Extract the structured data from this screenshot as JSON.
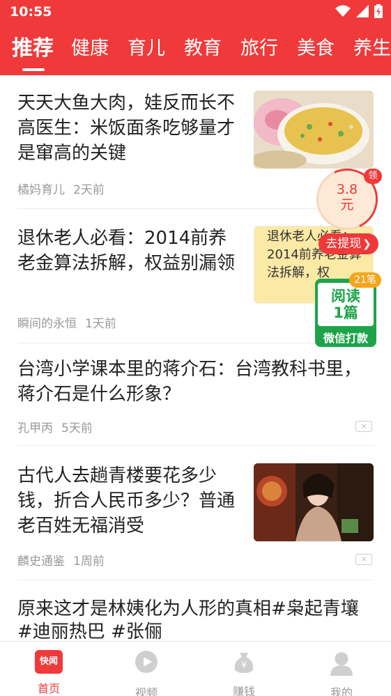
{
  "status_bar": {
    "time": "10:55"
  },
  "tabs": [
    "推荐",
    "健康",
    "育儿",
    "教育",
    "旅行",
    "美食",
    "养生"
  ],
  "feed": [
    {
      "title": "天天大鱼大肉，娃反而长不高医生：米饭面条吃够量才是窜高的关键",
      "source": "橘妈育儿",
      "time": "2天前"
    },
    {
      "title": "退休老人必看：2014前养老金算法拆解，权益别漏领",
      "source": "瞬间的永恒",
      "time": "1天前",
      "thumb_text": "退休老人必看：2014前养老金算法拆解，权"
    },
    {
      "title": "台湾小学课本里的蒋介石：台湾教科书里，蒋介石是什么形象？",
      "source": "孔甲丙",
      "time": "5天前"
    },
    {
      "title": "古代人去趟青楼要花多少钱，折合人民币多少？普通老百姓无福消受",
      "source": "麟史通鉴",
      "time": "1周前"
    },
    {
      "title": "原来这才是林姨化为人形的真相#枭起青壤#迪丽热巴 #张俪"
    }
  ],
  "widgets": {
    "coin_amount": "3.8",
    "coin_unit": "元",
    "coin_badge": "领",
    "withdraw_label": "去提现",
    "read_badge": "21笔",
    "read_line1": "阅读",
    "read_line2": "1篇",
    "read_footer": "微信打款"
  },
  "close_symbol": "×",
  "bottom_nav": [
    {
      "label": "首页",
      "icon_text": "快闻"
    },
    {
      "label": "视频"
    },
    {
      "label": "赚钱",
      "icon_text": "¥"
    },
    {
      "label": "我的"
    }
  ],
  "colors": {
    "brand_red": "#f0393a",
    "wechat_green": "#1da44a",
    "badge_orange": "#f4a51c"
  }
}
